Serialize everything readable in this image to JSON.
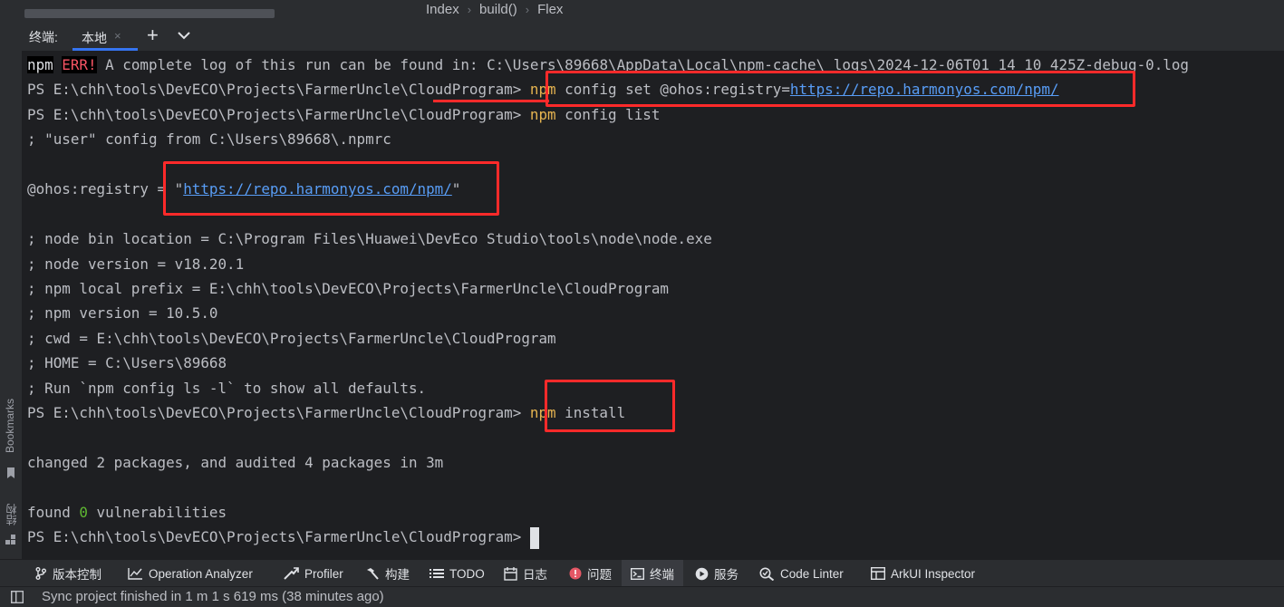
{
  "breadcrumb": [
    "Index",
    "build()",
    "Flex"
  ],
  "left_stripe": {
    "bookmarks": "Bookmarks",
    "structure": "结构"
  },
  "terminal_header": {
    "title": "终端:",
    "tab_label": "本地",
    "tab_close": "×",
    "add": "+"
  },
  "terminal": {
    "lines": [
      [
        {
          "t": "npm",
          "c": "npm-tag"
        },
        {
          "t": " "
        },
        {
          "t": "ERR!",
          "c": "err"
        },
        {
          "t": " A complete log of this run can be found in: C:\\Users\\89668\\AppData\\Local\\npm-cache\\_logs\\2024-12-06T01_14_10_425Z-debug-0.log"
        }
      ],
      [
        {
          "t": "PS E:\\chh\\tools\\DevECO\\Projects\\FarmerUncle\\CloudProgram> "
        },
        {
          "t": "npm",
          "c": "cmd"
        },
        {
          "t": " config set @ohos:registry="
        },
        {
          "t": "https://repo.harmonyos.com/npm/",
          "c": "link"
        }
      ],
      [
        {
          "t": "PS E:\\chh\\tools\\DevECO\\Projects\\FarmerUncle\\CloudProgram> "
        },
        {
          "t": "npm",
          "c": "cmd"
        },
        {
          "t": " config list"
        }
      ],
      [
        {
          "t": "; \"user\" config from C:\\Users\\89668\\.npmrc"
        }
      ],
      [
        {
          "t": ""
        }
      ],
      [
        {
          "t": "@ohos:registry = \""
        },
        {
          "t": "https://repo.harmonyos.com/npm/",
          "c": "link"
        },
        {
          "t": "\""
        }
      ],
      [
        {
          "t": ""
        }
      ],
      [
        {
          "t": "; node bin location = C:\\Program Files\\Huawei\\DevEco Studio\\tools\\node\\node.exe"
        }
      ],
      [
        {
          "t": "; node version = v18.20.1"
        }
      ],
      [
        {
          "t": "; npm local prefix = E:\\chh\\tools\\DevECO\\Projects\\FarmerUncle\\CloudProgram"
        }
      ],
      [
        {
          "t": "; npm version = 10.5.0"
        }
      ],
      [
        {
          "t": "; cwd = E:\\chh\\tools\\DevECO\\Projects\\FarmerUncle\\CloudProgram"
        }
      ],
      [
        {
          "t": "; HOME = C:\\Users\\89668"
        }
      ],
      [
        {
          "t": "; Run `npm config ls -l` to show all defaults."
        }
      ],
      [
        {
          "t": "PS E:\\chh\\tools\\DevECO\\Projects\\FarmerUncle\\CloudProgram> "
        },
        {
          "t": "npm",
          "c": "cmd"
        },
        {
          "t": " install"
        }
      ],
      [
        {
          "t": ""
        }
      ],
      [
        {
          "t": "changed 2 packages, and audited 4 packages in 3m"
        }
      ],
      [
        {
          "t": ""
        }
      ],
      [
        {
          "t": "found "
        },
        {
          "t": "0",
          "c": "green"
        },
        {
          "t": " vulnerabilities"
        }
      ],
      [
        {
          "t": "PS E:\\chh\\tools\\DevECO\\Projects\\FarmerUncle\\CloudProgram> "
        },
        {
          "t": "",
          "c": "cursor"
        }
      ]
    ]
  },
  "tool_windows": [
    {
      "label": "版本控制",
      "icon": "vcs-branch-icon"
    },
    {
      "label": "Operation Analyzer",
      "icon": "chart-icon"
    },
    {
      "label": "Profiler",
      "icon": "profiler-icon"
    },
    {
      "label": "构建",
      "icon": "hammer-icon"
    },
    {
      "label": "TODO",
      "icon": "list-icon"
    },
    {
      "label": "日志",
      "icon": "log-icon"
    },
    {
      "label": "问题",
      "icon": "problems-icon"
    },
    {
      "label": "终端",
      "icon": "terminal-icon",
      "active": true
    },
    {
      "label": "服务",
      "icon": "services-icon"
    },
    {
      "label": "Code Linter",
      "icon": "linter-icon"
    },
    {
      "label": "ArkUI Inspector",
      "icon": "inspector-icon"
    }
  ],
  "status_bar": {
    "message": "Sync project finished in 1 m 1 s 619 ms (38 minutes ago)",
    "icon": "layout-icon"
  },
  "colors": {
    "terminal_bg": "#1e1f22",
    "command": "#e6b450",
    "link": "#589df6",
    "error": "#f75464",
    "annotation": "#ff2a2a"
  }
}
